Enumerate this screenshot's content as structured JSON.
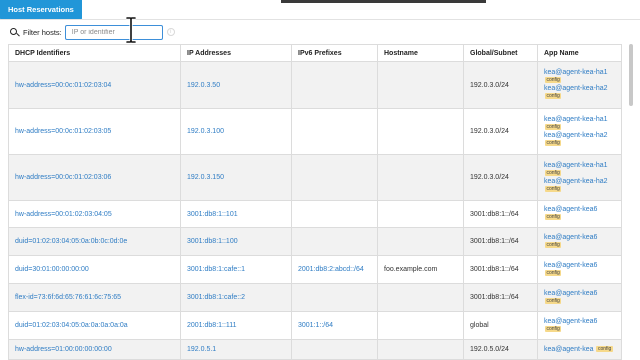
{
  "tab": {
    "label": "Host Reservations"
  },
  "filter": {
    "label": "Filter hosts:",
    "placeholder": "IP or identifier"
  },
  "table": {
    "columns": [
      "DHCP Identifiers",
      "IP Addresses",
      "IPv6 Prefixes",
      "Hostname",
      "Global/Subnet",
      "App Name"
    ],
    "rows": [
      {
        "identifier": "hw-address=00:0c:01:02:03:04",
        "ip": "192.0.3.50",
        "prefix": "",
        "hostname": "",
        "subnet": "192.0.3.0/24",
        "apps": [
          {
            "name": "kea@agent-kea-ha1",
            "badge": "config"
          },
          {
            "name": "kea@agent-kea-ha2",
            "badge": "config"
          }
        ]
      },
      {
        "identifier": "hw-address=00:0c:01:02:03:05",
        "ip": "192.0.3.100",
        "prefix": "",
        "hostname": "",
        "subnet": "192.0.3.0/24",
        "apps": [
          {
            "name": "kea@agent-kea-ha1",
            "badge": "config"
          },
          {
            "name": "kea@agent-kea-ha2",
            "badge": "config"
          }
        ]
      },
      {
        "identifier": "hw-address=00:0c:01:02:03:06",
        "ip": "192.0.3.150",
        "prefix": "",
        "hostname": "",
        "subnet": "192.0.3.0/24",
        "apps": [
          {
            "name": "kea@agent-kea-ha1",
            "badge": "config"
          },
          {
            "name": "kea@agent-kea-ha2",
            "badge": "config"
          }
        ]
      },
      {
        "identifier": "hw-address=00:01:02:03:04:05",
        "ip": "3001:db8:1::101",
        "prefix": "",
        "hostname": "",
        "subnet": "3001:db8:1::/64",
        "apps": [
          {
            "name": "kea@agent-kea6",
            "badge": "config"
          }
        ]
      },
      {
        "identifier": "duid=01:02:03:04:05:0a:0b:0c:0d:0e",
        "ip": "3001:db8:1::100",
        "prefix": "",
        "hostname": "",
        "subnet": "3001:db8:1::/64",
        "apps": [
          {
            "name": "kea@agent-kea6",
            "badge": "config"
          }
        ]
      },
      {
        "identifier": "duid=30:01:00:00:00:00",
        "ip": "3001:db8:1:cafe::1",
        "prefix": "2001:db8:2:abcd::/64",
        "hostname": "foo.example.com",
        "subnet": "3001:db8:1::/64",
        "apps": [
          {
            "name": "kea@agent-kea6",
            "badge": "config"
          }
        ]
      },
      {
        "identifier": "flex-id=73:6f:6d:65:76:61:6c:75:65",
        "ip": "3001:db8:1:cafe::2",
        "prefix": "",
        "hostname": "",
        "subnet": "3001:db8:1::/64",
        "apps": [
          {
            "name": "kea@agent-kea6",
            "badge": "config"
          }
        ]
      },
      {
        "identifier": "duid=01:02:03:04:05:0a:0a:0a:0a:0a",
        "ip": "2001:db8:1::111",
        "prefix": "3001:1::/64",
        "hostname": "",
        "subnet": "global",
        "apps": [
          {
            "name": "kea@agent-kea6",
            "badge": "config"
          }
        ]
      },
      {
        "identifier": "hw-address=01:00:00:00:00:00",
        "ip": "192.0.5.1",
        "prefix": "",
        "hostname": "",
        "subnet": "192.0.5.0/24",
        "apps": [
          {
            "name": "kea@agent-kea",
            "badge": "config"
          }
        ]
      }
    ]
  },
  "colors": {
    "accent": "#2196d8",
    "link": "#2e7cc4",
    "badge": "#f6d98a",
    "stripe": "#f2f2f2",
    "border": "#dcdcdc"
  }
}
